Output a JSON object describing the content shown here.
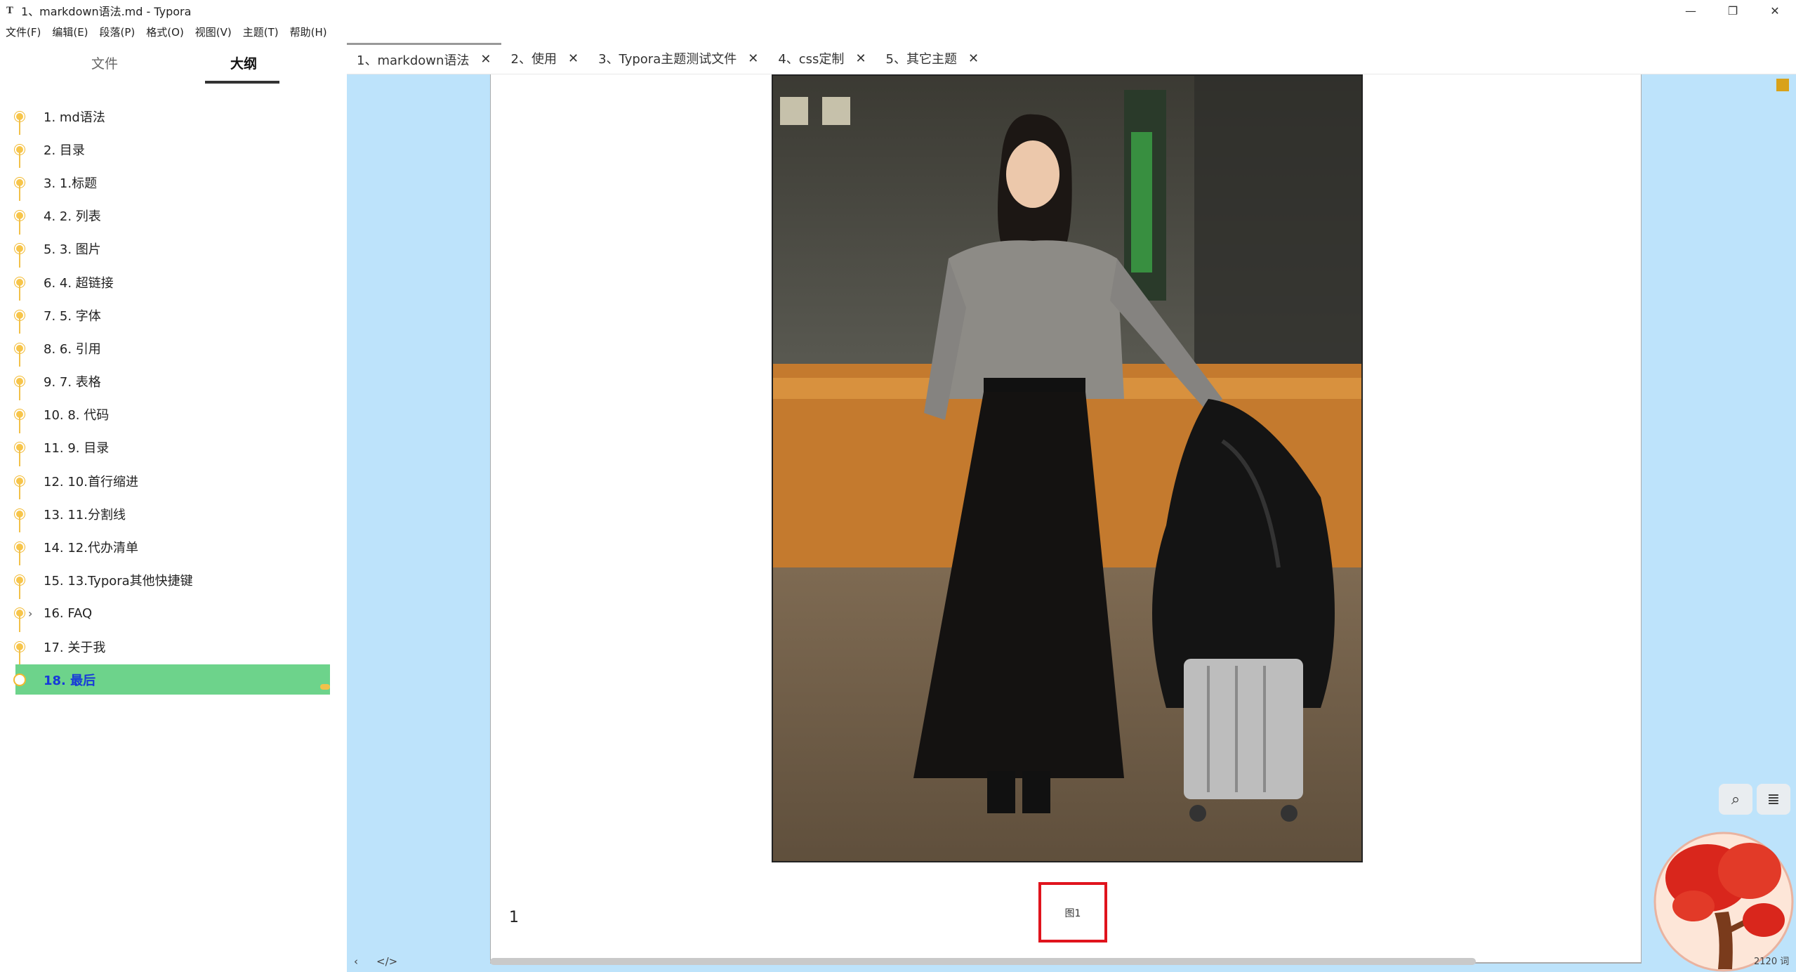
{
  "window": {
    "icon": "T",
    "title": "1、markdown语法.md - Typora",
    "controls": {
      "minimize": "—",
      "restore": "❐",
      "close": "✕"
    }
  },
  "menu": [
    "文件(F)",
    "编辑(E)",
    "段落(P)",
    "格式(O)",
    "视图(V)",
    "主题(T)",
    "帮助(H)"
  ],
  "sidebar": {
    "tabs": {
      "files": "文件",
      "outline": "大纲"
    },
    "items": [
      {
        "label": "1. md语法"
      },
      {
        "label": "2. 目录"
      },
      {
        "label": "3. 1.标题"
      },
      {
        "label": "4. 2. 列表"
      },
      {
        "label": "5. 3. 图片"
      },
      {
        "label": "6. 4. 超链接"
      },
      {
        "label": "7. 5. 字体"
      },
      {
        "label": "8. 6. 引用"
      },
      {
        "label": "9. 7. 表格"
      },
      {
        "label": "10. 8. 代码"
      },
      {
        "label": "11. 9. 目录"
      },
      {
        "label": "12. 10.首行缩进"
      },
      {
        "label": "13. 11.分割线"
      },
      {
        "label": "14. 12.代办清单"
      },
      {
        "label": "15. 13.Typora其他快捷键"
      },
      {
        "label": "16. FAQ",
        "chevron": "›"
      },
      {
        "label": "17. 关于我"
      },
      {
        "label": "18. 最后",
        "active": true
      }
    ]
  },
  "tabs": [
    {
      "label": "1、markdown语法",
      "active": true
    },
    {
      "label": "2、使用"
    },
    {
      "label": "3、Typora主题测试文件"
    },
    {
      "label": "4、css定制"
    },
    {
      "label": "5、其它主题"
    }
  ],
  "tab_close_glyph": "✕",
  "document": {
    "image_caption": "图1",
    "paragraph_number": "1"
  },
  "bottom_icons": {
    "back": "‹",
    "source": "</>"
  },
  "floating": {
    "search_icon": "⌕",
    "list_icon": "≣"
  },
  "status": {
    "word_count": "2120 词"
  },
  "colors": {
    "sidebar_active_bg": "#6dd38b",
    "outline_dot": "#f7c54a",
    "main_bg": "#bde3fb",
    "caption_border": "#e0141d",
    "active_label": "#1739d9"
  }
}
